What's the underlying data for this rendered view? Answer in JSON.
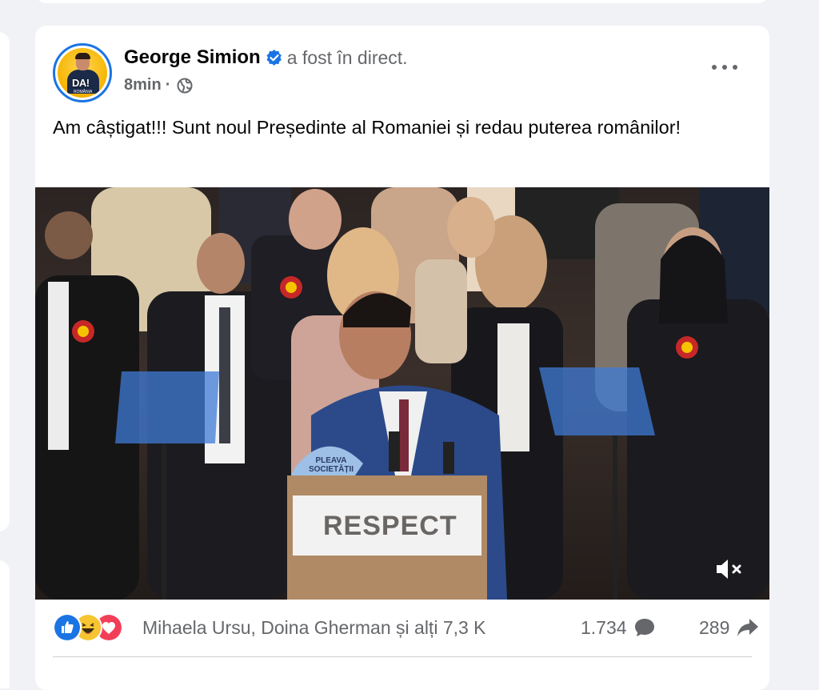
{
  "post": {
    "author": "George Simion",
    "action": "a fost în direct.",
    "time": "8min",
    "separator": "·",
    "text": "Am câștigat!!! Sunt noul Președinte al Romaniei și redau puterea românilor!",
    "avatar_text": "DA!",
    "avatar_subtext": "ROMÂNIA",
    "podium_text": "RESPECT",
    "cap_text_1": "PLEAVA",
    "cap_text_2": "SOCIETĂȚII"
  },
  "reactions": {
    "icons": [
      "like-icon",
      "haha-icon",
      "love-icon"
    ],
    "summary": "Mihaela Ursu, Doina Gherman și alți 7,3 K",
    "comments_count": "1.734",
    "shares_count": "289"
  },
  "colors": {
    "accent": "#1b74e4",
    "text_secondary": "#65676b",
    "background": "#f0f2f5"
  }
}
